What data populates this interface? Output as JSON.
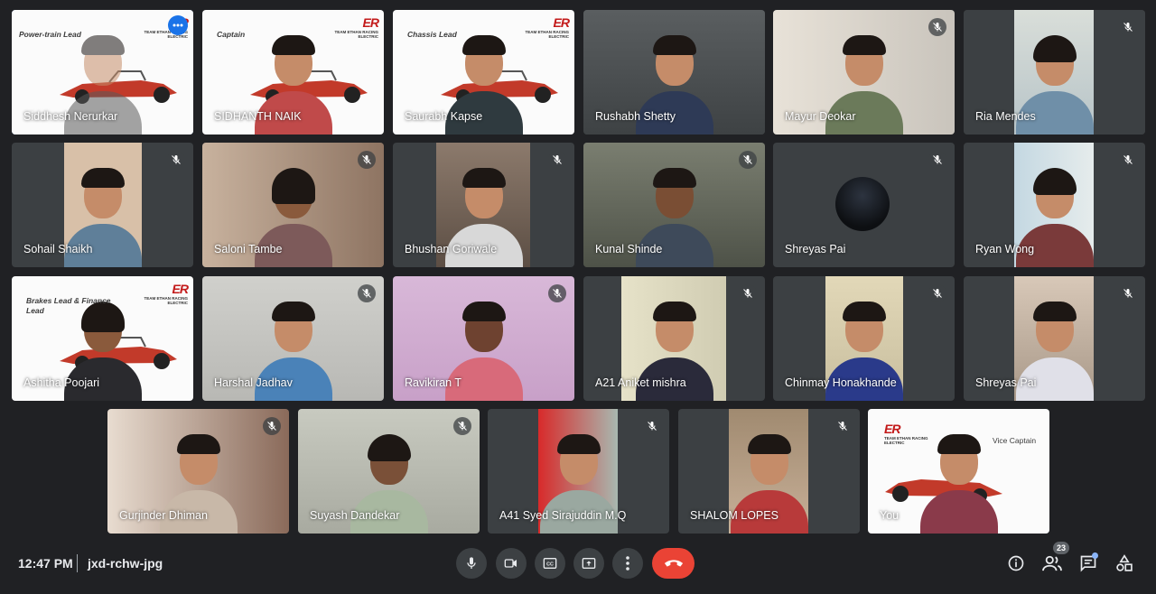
{
  "meeting": {
    "time": "12:47 PM",
    "code": "jxd-rchw-jpg"
  },
  "participant_count": "23",
  "logo_text": "ER",
  "logo_sub": "TEAM ETHAN RACING ELECTRIC",
  "tiles": [
    {
      "name": "Siddhesh Nerurkar",
      "role": "Power-train Lead"
    },
    {
      "name": "SIDHANTH NAIK",
      "role": "Captain"
    },
    {
      "name": "Saurabh Kapse",
      "role": "Chassis Lead"
    },
    {
      "name": "Rushabh Shetty"
    },
    {
      "name": "Mayur Deokar"
    },
    {
      "name": "Ria Mendes"
    },
    {
      "name": "Sohail Shaikh"
    },
    {
      "name": "Saloni Tambe"
    },
    {
      "name": "Bhushan Goriwale"
    },
    {
      "name": "Kunal Shinde"
    },
    {
      "name": "Shreyas Pai"
    },
    {
      "name": "Ryan Wong"
    },
    {
      "name": "Ashitha Poojari",
      "role": "Brakes Lead & Finance Lead"
    },
    {
      "name": "Harshal Jadhav"
    },
    {
      "name": "Ravikiran T"
    },
    {
      "name": "A21 Aniket mishra"
    },
    {
      "name": "Chinmay Honakhande"
    },
    {
      "name": "Shreyas Pai"
    },
    {
      "name": "Gurjinder Dhiman"
    },
    {
      "name": "Suyash Dandekar"
    },
    {
      "name": "A41 Syed Sirajuddin M.Q"
    },
    {
      "name": "SHALOM LOPES"
    },
    {
      "name": "You",
      "role": "Vice Captain"
    }
  ],
  "icons": [
    "mic-icon",
    "camera-icon",
    "captions-icon",
    "present-icon",
    "more-options-icon",
    "hangup-icon",
    "info-icon",
    "people-icon",
    "chat-icon",
    "activities-icon",
    "mic-off-icon"
  ]
}
